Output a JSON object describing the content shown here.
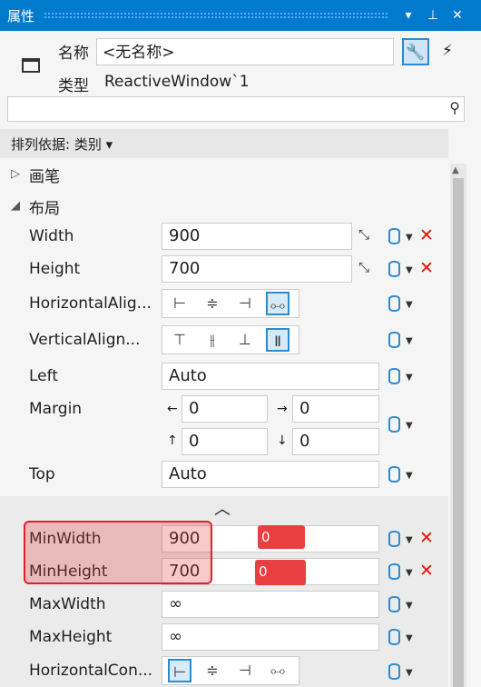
{
  "panel": {
    "title": "属性",
    "dropdown_icon": "▾",
    "pin_icon": "⊥",
    "close_icon": "✕"
  },
  "header": {
    "name_label": "名称",
    "name_value": "<无名称>",
    "type_label": "类型",
    "type_value": "ReactiveWindow`1"
  },
  "sort": {
    "label": "排列依据: 类别 ▾"
  },
  "groups": {
    "brush": "画笔",
    "layout": "布局"
  },
  "props": {
    "width": {
      "label": "Width",
      "value": "900"
    },
    "height": {
      "label": "Height",
      "value": "700"
    },
    "horizontal_alignment": {
      "label": "HorizontalAlig..."
    },
    "vertical_alignment": {
      "label": "VerticalAlign..."
    },
    "left": {
      "label": "Left",
      "value": "Auto"
    },
    "margin": {
      "label": "Margin",
      "left": "0",
      "right": "0",
      "top": "0",
      "bottom": "0"
    },
    "top": {
      "label": "Top",
      "value": "Auto"
    },
    "min_width": {
      "label": "MinWidth",
      "value": "900",
      "overlay": "0"
    },
    "min_height": {
      "label": "MinHeight",
      "value": "700",
      "overlay": "0"
    },
    "max_width": {
      "label": "MaxWidth",
      "value": "∞"
    },
    "max_height": {
      "label": "MaxHeight",
      "value": "∞"
    },
    "horizontal_content": {
      "label": "HorizontalCon..."
    }
  },
  "colors": {
    "title_bar": "#007acc",
    "highlight": "#e0202a",
    "accent": "#2c8bcf"
  }
}
